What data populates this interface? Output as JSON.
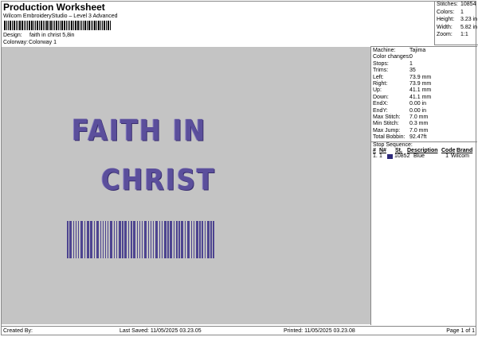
{
  "header": {
    "title": "Production Worksheet",
    "subtitle": "Wilcom EmbroideryStudio – Level 3 Advanced",
    "design_label": "Design:",
    "design": "faith in christ 5,8in",
    "colorway_label": "Colorway:",
    "colorway": "Colorway 1"
  },
  "stats": [
    {
      "k": "Stitches:",
      "v": "10854"
    },
    {
      "k": "Colors:",
      "v": "1"
    },
    {
      "k": "Height:",
      "v": "3.23 in"
    },
    {
      "k": "Width:",
      "v": "5.82 in"
    },
    {
      "k": "Zoom:",
      "v": "1:1"
    }
  ],
  "info": [
    {
      "k": "Machine:",
      "v": "Tajima"
    },
    {
      "k": "Color changes:",
      "v": "0"
    },
    {
      "k": "Stops:",
      "v": "1"
    },
    {
      "k": "Trims:",
      "v": "35"
    },
    {
      "k": "Left:",
      "v": "73.9 mm"
    },
    {
      "k": "Right:",
      "v": "73.9 mm"
    },
    {
      "k": "Up:",
      "v": "41.1 mm"
    },
    {
      "k": "Down:",
      "v": "41.1 mm"
    },
    {
      "k": "EndX:",
      "v": "0.00 in"
    },
    {
      "k": "EndY:",
      "v": "0.00 in"
    },
    {
      "k": "Max Stitch:",
      "v": "7.0 mm"
    },
    {
      "k": "Min Stitch:",
      "v": "0.3 mm"
    },
    {
      "k": "Max Jump:",
      "v": "7.0 mm"
    },
    {
      "k": "Total Bobbin:",
      "v": "92.47ft"
    }
  ],
  "stop_sequence": {
    "title": "Stop Sequence:",
    "columns": [
      "#",
      "N#",
      "St.",
      "Description",
      "Code",
      "Brand"
    ],
    "rows": [
      {
        "num": "1.",
        "n": "1",
        "color": "#2e2a7a",
        "st": "10852",
        "desc": "Blue",
        "code": "1",
        "brand": "Wilcom"
      }
    ]
  },
  "design_text": {
    "line1": "FAITH IN",
    "line2": "CHRIST"
  },
  "footer": {
    "created": "Created By:",
    "saved": "Last Saved: 11/05/2025 03.23.05",
    "printed": "Printed: 11/05/2025 03.23.08",
    "page": "Page 1 of 1"
  }
}
